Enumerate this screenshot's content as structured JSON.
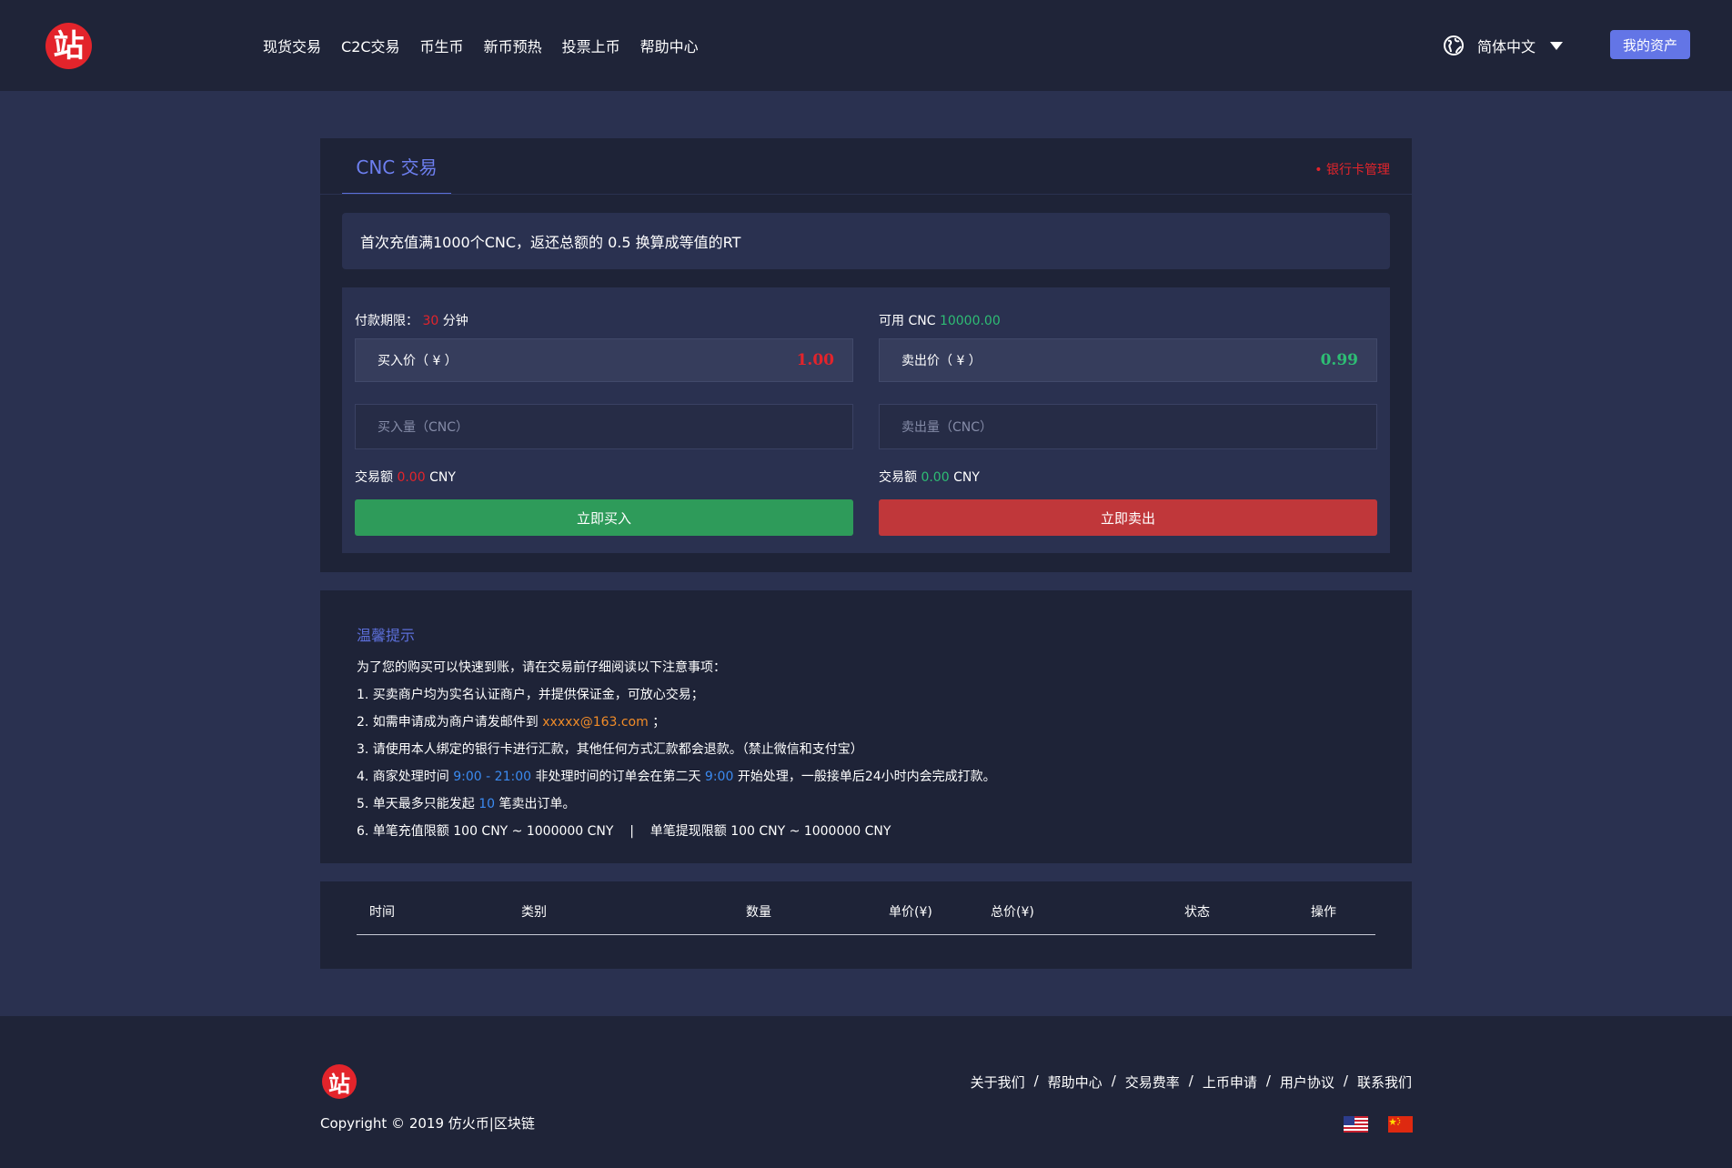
{
  "header": {
    "nav": [
      "现货交易",
      "C2C交易",
      "币生币",
      "新币预热",
      "投票上币",
      "帮助中心"
    ],
    "language": "简体中文",
    "assets_button": "我的资产"
  },
  "trade": {
    "tab": "CNC 交易",
    "bank_link": "• 银行卡管理",
    "notice": "首次充值满1000个CNC，返还总额的 0.5 换算成等值的RT",
    "buy": {
      "period_label": "付款期限：",
      "period_value": "30",
      "period_unit": "分钟",
      "price_label": "买入价（ ¥ ）",
      "price_value": "1.00",
      "qty_placeholder": "买入量（CNC）",
      "amount_label": "交易额",
      "amount_value": "0.00",
      "amount_unit": "CNY",
      "button": "立即买入"
    },
    "sell": {
      "avail_label": "可用 CNC",
      "avail_value": "10000.00",
      "price_label": "卖出价（ ¥ ）",
      "price_value": "0.99",
      "qty_placeholder": "卖出量（CNC）",
      "amount_label": "交易额",
      "amount_value": "0.00",
      "amount_unit": "CNY",
      "button": "立即卖出"
    }
  },
  "tips": {
    "title": "温馨提示",
    "intro": "为了您的购买可以快速到账，请在交易前仔细阅读以下注意事项：",
    "l1": "1. 买卖商户均为实名认证商户，并提供保证金，可放心交易；",
    "l2_pre": "2. 如需申请成为商户请发邮件到 ",
    "l2_email": "xxxxx@163.com",
    "l2_post": " ；",
    "l3": "3. 请使用本人绑定的银行卡进行汇款，其他任何方式汇款都会退款。（禁止微信和支付宝）",
    "l4_pre": "4. 商家处理时间 ",
    "l4_time": "9:00 - 21:00",
    "l4_mid": " 非处理时间的订单会在第二天 ",
    "l4_time2": "9:00",
    "l4_post": " 开始处理，一般接单后24小时内会完成打款。",
    "l5_pre": "5. 单天最多只能发起 ",
    "l5_num": "10",
    "l5_post": " 笔卖出订单。",
    "l6": "6. 单笔充值限额 100 CNY ~ 1000000 CNY    |    单笔提现限额 100 CNY ~ 1000000 CNY"
  },
  "history": {
    "columns": [
      "时间",
      "类别",
      "数量",
      "单价(¥)",
      "总价(¥)",
      "状态",
      "操作"
    ]
  },
  "footer": {
    "copyright": "Copyright © 2019 仿火币|区块链",
    "links": [
      "关于我们",
      "帮助中心",
      "交易费率",
      "上币申请",
      "用户协议",
      "联系我们"
    ],
    "link_separator": "/"
  },
  "colors": {
    "accent": "#6375e6",
    "buy_green": "#2e9b5a",
    "sell_red": "#c0373a",
    "up_red": "#e3242b",
    "down_green": "#2ebd74"
  }
}
